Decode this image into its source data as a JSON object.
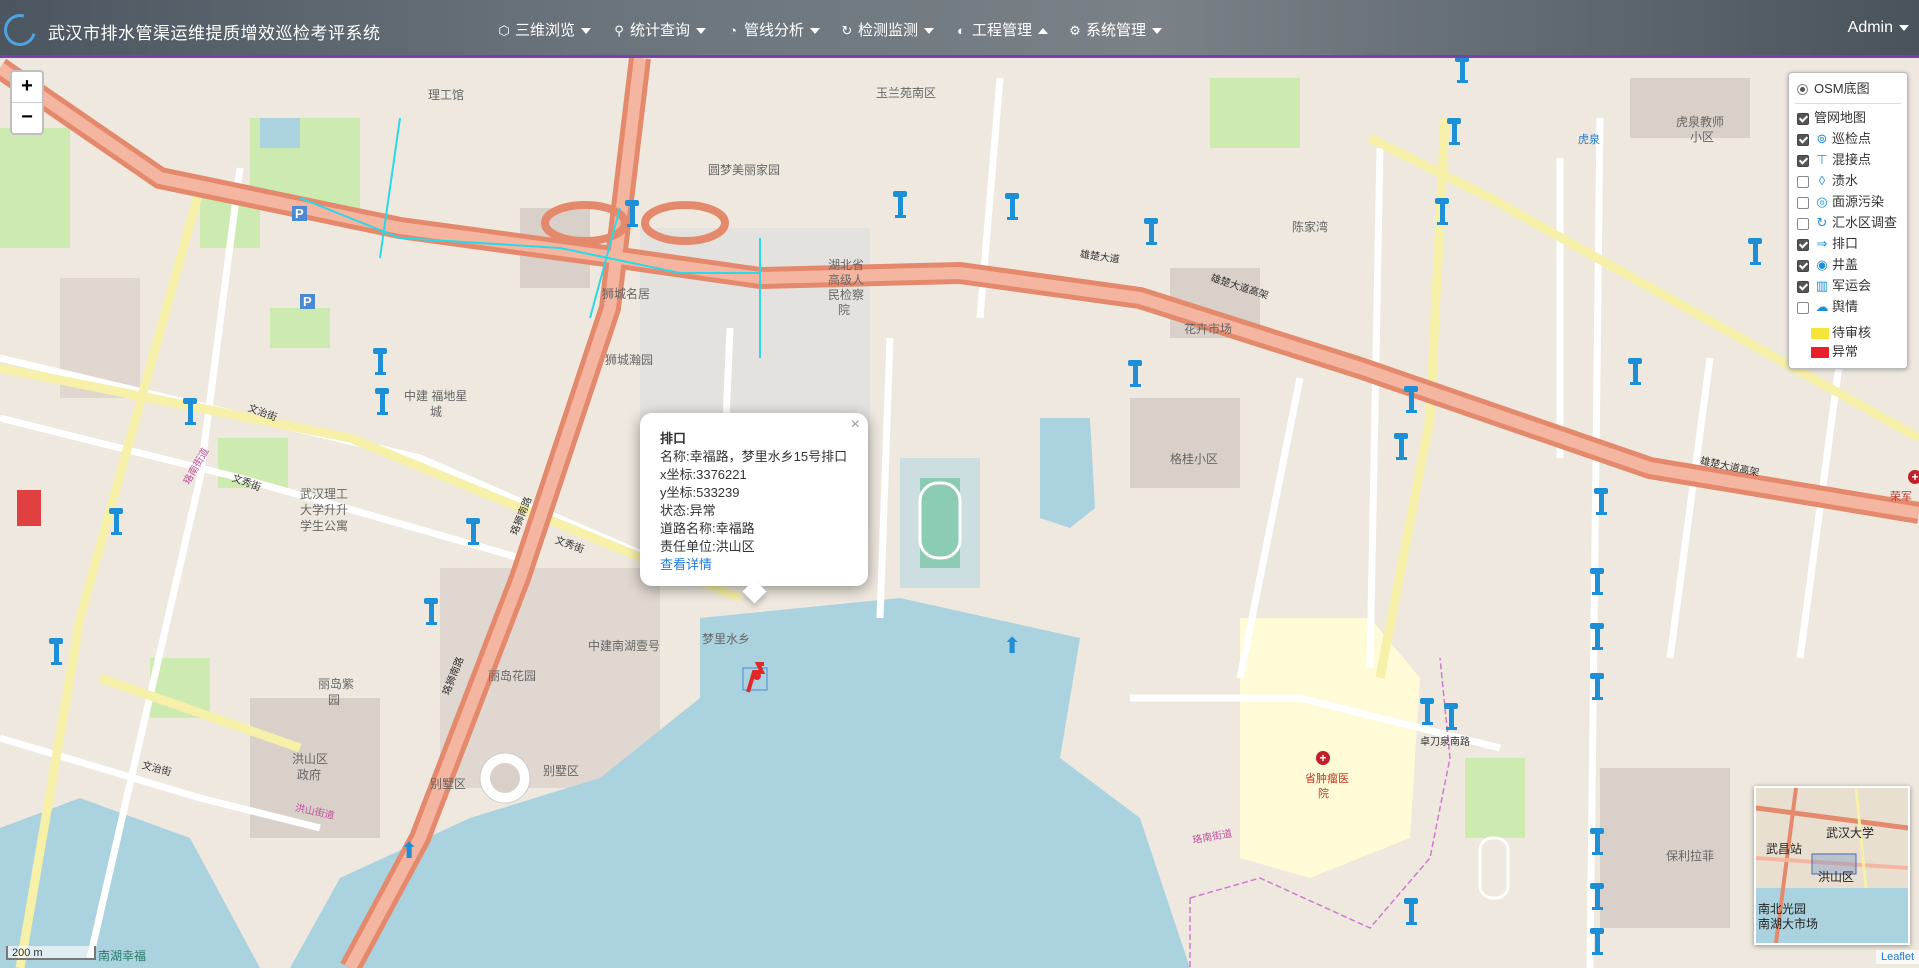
{
  "app": {
    "title": "武汉市排水管渠运维提质增效巡检考评系统",
    "user": "Admin"
  },
  "nav": [
    {
      "label": "三维浏览",
      "icon": "cube-icon",
      "caret": "down"
    },
    {
      "label": "统计查询",
      "icon": "search-icon",
      "caret": "down"
    },
    {
      "label": "管线分析",
      "icon": "gauge-icon",
      "caret": "down"
    },
    {
      "label": "检测监测",
      "icon": "refresh-icon",
      "caret": "down"
    },
    {
      "label": "工程管理",
      "icon": "palette-icon",
      "caret": "up"
    },
    {
      "label": "系统管理",
      "icon": "gear-icon",
      "caret": "down"
    }
  ],
  "zoom": {
    "in": "+",
    "out": "−"
  },
  "layers": {
    "base": {
      "label": "OSM底图",
      "checked": true
    },
    "items": [
      {
        "label": "管网地图",
        "checked": true,
        "icon": "",
        "icon_name": "none"
      },
      {
        "label": "巡检点",
        "checked": true,
        "icon": "⊚",
        "icon_name": "inspection-point-icon"
      },
      {
        "label": "混接点",
        "checked": true,
        "icon": "⊤",
        "icon_name": "mixed-connection-icon"
      },
      {
        "label": "渍水",
        "checked": false,
        "icon": "◊",
        "icon_name": "waterlogging-icon"
      },
      {
        "label": "面源污染",
        "checked": false,
        "icon": "◎",
        "icon_name": "nonpoint-pollution-icon"
      },
      {
        "label": "汇水区调查",
        "checked": false,
        "icon": "↻",
        "icon_name": "catchment-survey-icon"
      },
      {
        "label": "排口",
        "checked": true,
        "icon": "⇒",
        "icon_name": "outfall-icon"
      },
      {
        "label": "井盖",
        "checked": true,
        "icon": "◉",
        "icon_name": "manhole-cover-icon"
      },
      {
        "label": "军运会",
        "checked": true,
        "icon": "▥",
        "icon_name": "military-games-icon"
      },
      {
        "label": "舆情",
        "checked": false,
        "icon": "☁",
        "icon_name": "public-opinion-icon"
      }
    ],
    "legend": [
      {
        "label": "待审核",
        "color": "#f5e53b"
      },
      {
        "label": "异常",
        "color": "#e8202a"
      }
    ]
  },
  "popup": {
    "title": "排口",
    "name": "名称:幸福路，梦里水乡15号排口",
    "x": "x坐标:3376221",
    "y": "y坐标:533239",
    "status": "状态:异常",
    "road": "道路名称:幸福路",
    "unit": "责任单位:洪山区",
    "link": "查看详情",
    "close": "×"
  },
  "map_labels": {
    "ligong": "理工馆",
    "yulan": "玉兰苑南区",
    "yuanmeng": "圆梦美丽家园",
    "hubeiA": "湖北省",
    "hubeiB": "高级人",
    "hubeiC": "民检察",
    "hubeiD": "院",
    "chenjiawan": "陈家湾",
    "huquanA": "虎泉教师",
    "huquanB": "小区",
    "huahui": "花卉市场",
    "shichengA": "狮城名居",
    "shichengB": "狮城瀚园",
    "zhongjianA": "中建 福地星",
    "zhongjianB": "城",
    "wutA": "武汉理工",
    "wutB": "大学升升",
    "wutC": "学生公寓",
    "gegui": "格桂小区",
    "zhongjianNanhu": "中建南湖壹号",
    "menglishuixiang": "梦里水乡",
    "lidaoHuayuan": "丽岛花园",
    "lidaoZiyuanA": "丽岛紫",
    "lidaoZiyuanB": "园",
    "hongshanA": "洪山区",
    "hongshanB": "政府",
    "bieshuA": "别墅区",
    "bieshuB": "别墅区",
    "zhongliuA": "省肿瘤医",
    "zhongliuB": "院",
    "baoli": "保利拉菲",
    "yongmingRd": "卓刀泉南路",
    "luonanSt": "珞南街道",
    "luonanSt2": "珞南街道",
    "hongshanSt": "洪山街道",
    "wenzhiSt": "文治街",
    "wenxiuSt": "文秀街",
    "wenxiuSt2": "文秀街",
    "wenzhiSt2": "文治街",
    "luoshiRd": "珞狮南路",
    "luoshiRd2": "珞狮南路",
    "xiongchu": "雄楚大道高架",
    "xiongchu2": "雄楚大道高架",
    "xiongchu3": "雄楚大道",
    "huquan": "虎泉",
    "rongjun": "荣军",
    "parkingA": "P",
    "parkingB": "P"
  },
  "minimap": {
    "labels": [
      "武汉大学",
      "武昌站",
      "洪山区",
      "南北光园",
      "南湖大市场"
    ]
  },
  "scale": {
    "label": "200 m",
    "extra": "南湖幸福"
  },
  "attribution": "Leaflet"
}
